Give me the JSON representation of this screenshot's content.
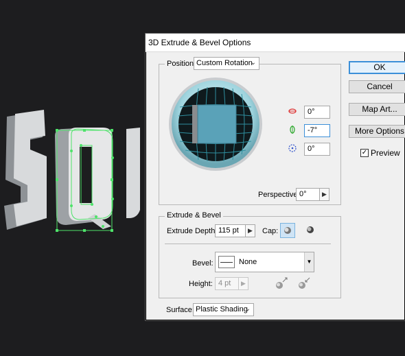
{
  "dialog": {
    "title": "3D Extrude & Bevel Options",
    "position": {
      "label": "Position:",
      "value": "Custom Rotation",
      "rotation_x": "0°",
      "rotation_y": "-7°",
      "rotation_z": "0°",
      "perspective_label": "Perspective:",
      "perspective": "0°"
    },
    "extrude": {
      "legend": "Extrude & Bevel",
      "depth_label": "Extrude Depth:",
      "depth": "115 pt",
      "cap_label": "Cap:",
      "bevel_label": "Bevel:",
      "bevel_value": "None",
      "height_label": "Height:",
      "height": "4 pt"
    },
    "surface": {
      "label": "Surface:",
      "value": "Plastic Shading"
    },
    "buttons": {
      "ok": "OK",
      "cancel": "Cancel",
      "map_art": "Map Art...",
      "more_options": "More Options"
    },
    "preview": {
      "label": "Preview",
      "checked": true
    }
  },
  "canvas": {
    "letters": "SQU"
  },
  "colors": {
    "canvas_bg": "#1d1d1f",
    "selection": "#4ee36a",
    "cube_face": "#5aa2b8",
    "sphere_ring": "#a8dbe4",
    "focus_border": "#3b8fd8"
  }
}
